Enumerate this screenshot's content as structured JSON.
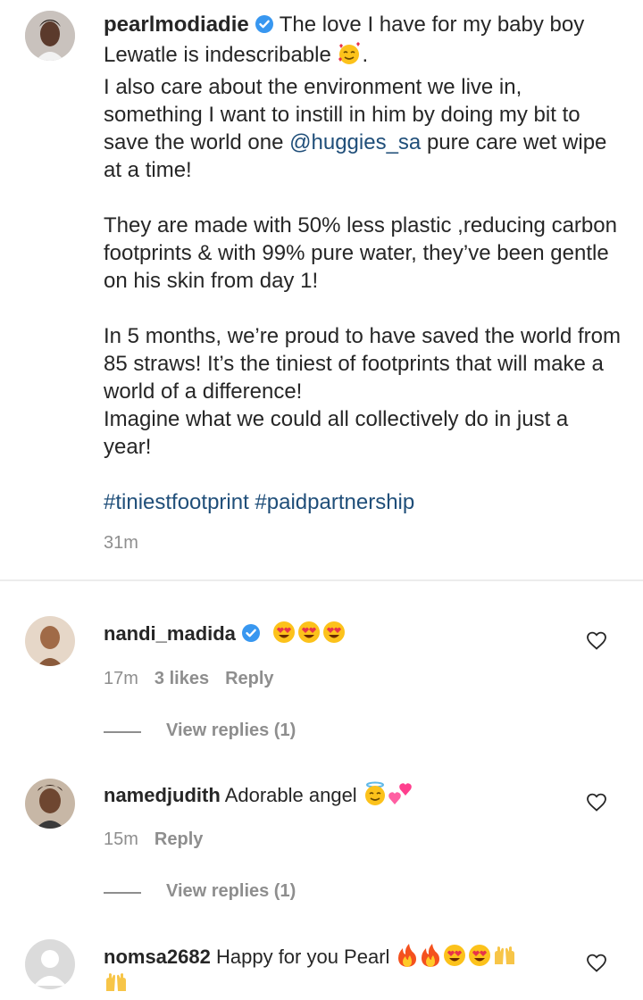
{
  "post": {
    "username": "pearlmodiadie",
    "caption_line1": "The love I have for my baby boy",
    "caption_line2": "Lewatle is indescribable",
    "caption_line2_end": ".",
    "para1_a": "I also care about the environment we live in, something I want to instill in him by doing my bit to save the world one",
    "mention": "@huggies_sa",
    "para1_b": "pure care wet wipe at a time!",
    "para2": "They are made with 50% less plastic ,reducing carbon footprints & with 99% pure water, they’ve been gentle on his skin from day 1!",
    "para3": "In 5 months, we’re proud to have saved the world from 85 straws! It’s the tiniest of footprints that will make a world of a difference!",
    "para3_b": "Imagine what we could all collectively do in just a year!",
    "hashtags": "#tiniestfootprint #paidpartnership",
    "time": "31m"
  },
  "comments": [
    {
      "username": "nandi_madida",
      "text": "",
      "time": "17m",
      "likes": "3 likes",
      "reply": "Reply",
      "view_replies": "View replies (1)"
    },
    {
      "username": "namedjudith",
      "text": "Adorable angel",
      "time": "15m",
      "reply": "Reply",
      "view_replies": "View replies (1)"
    },
    {
      "username": "nomsa2682",
      "text": "Happy for you Pearl"
    }
  ],
  "colors": {
    "link": "#1f4e79",
    "verified": "#3897f0",
    "muted": "#8e8e8e"
  },
  "icons": [
    "verified-badge-icon",
    "heart-outline-icon",
    "heart-eyes-emoji",
    "smiling-hearts-emoji",
    "halo-emoji",
    "sparkling-heart-emoji",
    "fire-emoji",
    "raised-hands-emoji"
  ]
}
